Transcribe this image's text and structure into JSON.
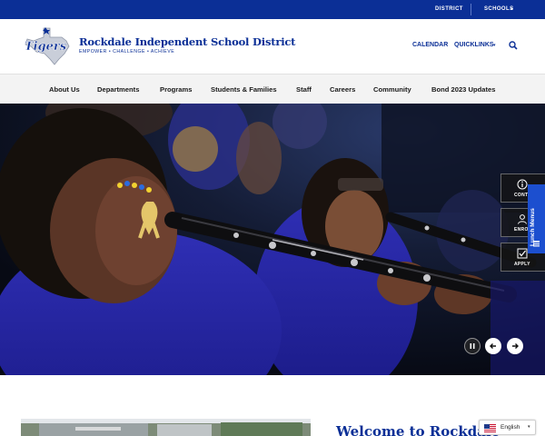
{
  "topbar": {
    "district_label": "DISTRICT",
    "schools_label": "SCHOOLS",
    "schools_caret": "▾"
  },
  "header": {
    "logo_icon": "tigers-texas-logo",
    "logo_text": "Tigers",
    "school_name": "Rockdale Independent School District",
    "tagline": "EMPOWER • CHALLENGE • ACHIEVE",
    "calendar_label": "CALENDAR",
    "quicklinks_label": "QUICKLINKS",
    "quicklinks_caret": "▾",
    "search_icon": "search-icon"
  },
  "nav": {
    "items": [
      {
        "label": "About Us"
      },
      {
        "label": "Departments"
      },
      {
        "label": "Programs"
      },
      {
        "label": "Students & Families"
      },
      {
        "label": "Staff"
      },
      {
        "label": "Careers"
      },
      {
        "label": "Community"
      },
      {
        "label": "Bond 2023 Updates"
      }
    ]
  },
  "hero": {
    "side_buttons": [
      {
        "label": "CONTACT",
        "icon": "info-icon"
      },
      {
        "label": "ENROLL",
        "icon": "person-icon"
      },
      {
        "label": "APPLY",
        "icon": "checkbox-icon"
      }
    ],
    "lunch_tab": {
      "label": "Lunch Menus",
      "icon": "utensils-icon"
    },
    "controls": {
      "pause_icon": "pause-icon",
      "prev_icon": "arrow-left-icon",
      "next_icon": "arrow-right-icon"
    }
  },
  "welcome": {
    "title": "Welcome to Rockdale"
  },
  "language": {
    "label": "English",
    "flag_icon": "us-flag-icon",
    "caret": "▾"
  },
  "colors": {
    "brand_blue": "#0b2f96",
    "nav_bg": "#f3f3f3",
    "lunch_blue": "#1c4fcf"
  }
}
